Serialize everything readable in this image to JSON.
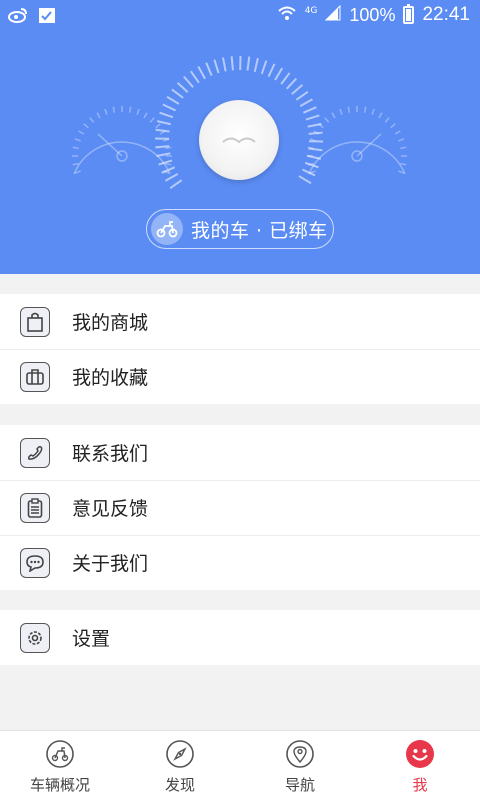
{
  "status_bar": {
    "network": "4G",
    "battery": "100%",
    "time": "22:41",
    "icons": [
      "weibo-icon",
      "calendar-check-icon",
      "wifi-icon",
      "signal-icon",
      "battery-icon"
    ]
  },
  "header": {
    "background_color": "#5b8cf4",
    "car_status": "我的车 · 已绑车"
  },
  "menu": {
    "section1": [
      {
        "label": "我的商城",
        "icon": "shopping-bag-icon"
      },
      {
        "label": "我的收藏",
        "icon": "briefcase-icon"
      }
    ],
    "section2": [
      {
        "label": "联系我们",
        "icon": "phone-icon"
      },
      {
        "label": "意见反馈",
        "icon": "clipboard-icon"
      },
      {
        "label": "关于我们",
        "icon": "chat-bubble-icon"
      }
    ],
    "section3": [
      {
        "label": "设置",
        "icon": "gear-icon"
      }
    ]
  },
  "bottom_nav": {
    "active_color": "#e8364a",
    "items": [
      {
        "label": "车辆概况",
        "icon": "scooter-icon"
      },
      {
        "label": "发现",
        "icon": "compass-icon"
      },
      {
        "label": "导航",
        "icon": "location-pin-icon"
      },
      {
        "label": "我",
        "icon": "smiley-icon",
        "active": true
      }
    ]
  }
}
